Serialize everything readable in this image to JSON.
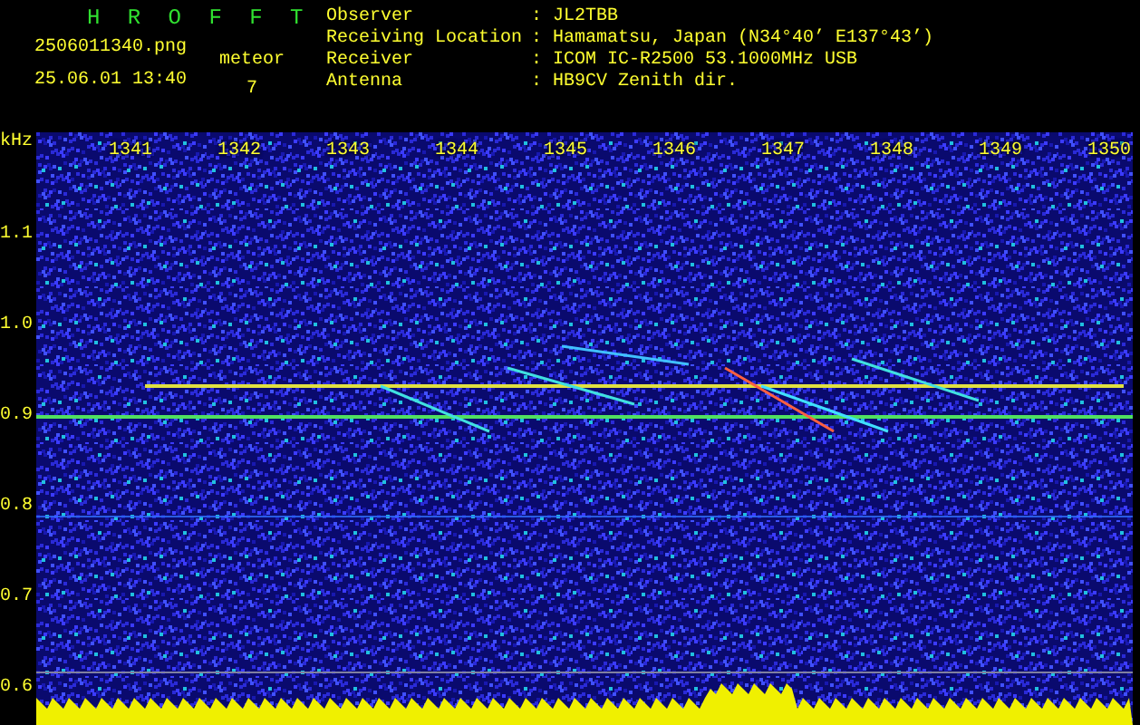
{
  "header": {
    "title": "H R O F F T",
    "filename": "2506011340.png",
    "datetime": "25.06.01 13:40",
    "meteor_label": "meteor",
    "meteor_count": "7",
    "info": [
      {
        "label": "Observer",
        "separator": ":",
        "value": "JL2TBB"
      },
      {
        "label": "Receiving Location",
        "separator": ":",
        "value": "Hamamatsu, Japan (N34°40’ E137°43’)"
      },
      {
        "label": "Receiver",
        "separator": ":",
        "value": "ICOM IC-R2500 53.1000MHz USB"
      },
      {
        "label": "Antenna",
        "separator": ":",
        "value": "HB9CV Zenith dir."
      }
    ]
  },
  "spectrogram": {
    "unit": "kHz",
    "x_labels": [
      "1341",
      "1342",
      "1343",
      "1344",
      "1345",
      "1346",
      "1347",
      "1348",
      "1349",
      "1350"
    ],
    "y_labels": [
      "1.1",
      "1.0",
      "0.9",
      "0.8",
      "0.7",
      "0.6"
    ]
  }
}
